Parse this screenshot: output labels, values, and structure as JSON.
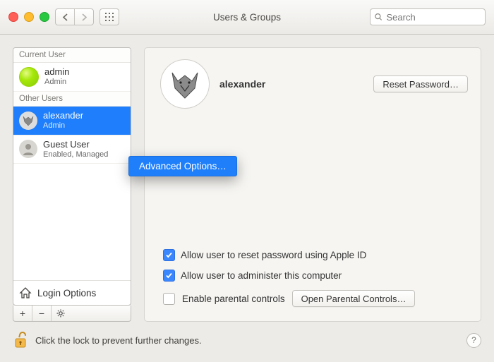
{
  "window": {
    "title": "Users & Groups",
    "search_placeholder": "Search"
  },
  "sidebar": {
    "current_header": "Current User",
    "current": {
      "name": "admin",
      "role": "Admin"
    },
    "other_header": "Other Users",
    "others": [
      {
        "name": "alexander",
        "role": "Admin"
      },
      {
        "name": "Guest User",
        "role": "Enabled, Managed"
      }
    ],
    "login_options": "Login Options"
  },
  "context_menu": {
    "advanced": "Advanced Options…"
  },
  "pane": {
    "display_name": "alexander",
    "reset_password": "Reset Password…",
    "allow_reset": "Allow user to reset password using Apple ID",
    "allow_admin": "Allow user to administer this computer",
    "parental_label": "Enable parental controls",
    "open_parental": "Open Parental Controls…"
  },
  "footer": {
    "lock_text": "Click the lock to prevent further changes.",
    "help": "?"
  }
}
